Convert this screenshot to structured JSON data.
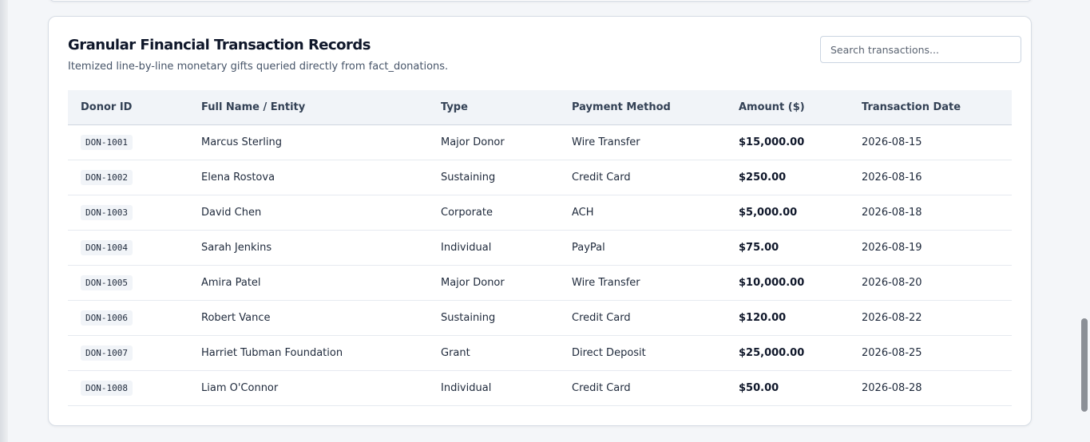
{
  "section": {
    "title": "Granular Financial Transaction Records",
    "subtitle": "Itemized line-by-line monetary gifts queried directly from fact_donations.",
    "search_placeholder": "Search transactions..."
  },
  "table": {
    "headers": [
      "Donor ID",
      "Full Name / Entity",
      "Type",
      "Payment Method",
      "Amount ($)",
      "Transaction Date"
    ],
    "rows": [
      {
        "id": "DON-1001",
        "name": "Marcus Sterling",
        "type": "Major Donor",
        "method": "Wire Transfer",
        "amount": "$15,000.00",
        "date": "2026-08-15"
      },
      {
        "id": "DON-1002",
        "name": "Elena Rostova",
        "type": "Sustaining",
        "method": "Credit Card",
        "amount": "$250.00",
        "date": "2026-08-16"
      },
      {
        "id": "DON-1003",
        "name": "David Chen",
        "type": "Corporate",
        "method": "ACH",
        "amount": "$5,000.00",
        "date": "2026-08-18"
      },
      {
        "id": "DON-1004",
        "name": "Sarah Jenkins",
        "type": "Individual",
        "method": "PayPal",
        "amount": "$75.00",
        "date": "2026-08-19"
      },
      {
        "id": "DON-1005",
        "name": "Amira Patel",
        "type": "Major Donor",
        "method": "Wire Transfer",
        "amount": "$10,000.00",
        "date": "2026-08-20"
      },
      {
        "id": "DON-1006",
        "name": "Robert Vance",
        "type": "Sustaining",
        "method": "Credit Card",
        "amount": "$120.00",
        "date": "2026-08-22"
      },
      {
        "id": "DON-1007",
        "name": "Harriet Tubman Foundation",
        "type": "Grant",
        "method": "Direct Deposit",
        "amount": "$25,000.00",
        "date": "2026-08-25"
      },
      {
        "id": "DON-1008",
        "name": "Liam O'Connor",
        "type": "Individual",
        "method": "Credit Card",
        "amount": "$50.00",
        "date": "2026-08-28"
      }
    ]
  },
  "colors": {
    "page_background": "#f4f6f9",
    "header_background": "#f1f4f8",
    "text_primary": "#0f172a"
  }
}
